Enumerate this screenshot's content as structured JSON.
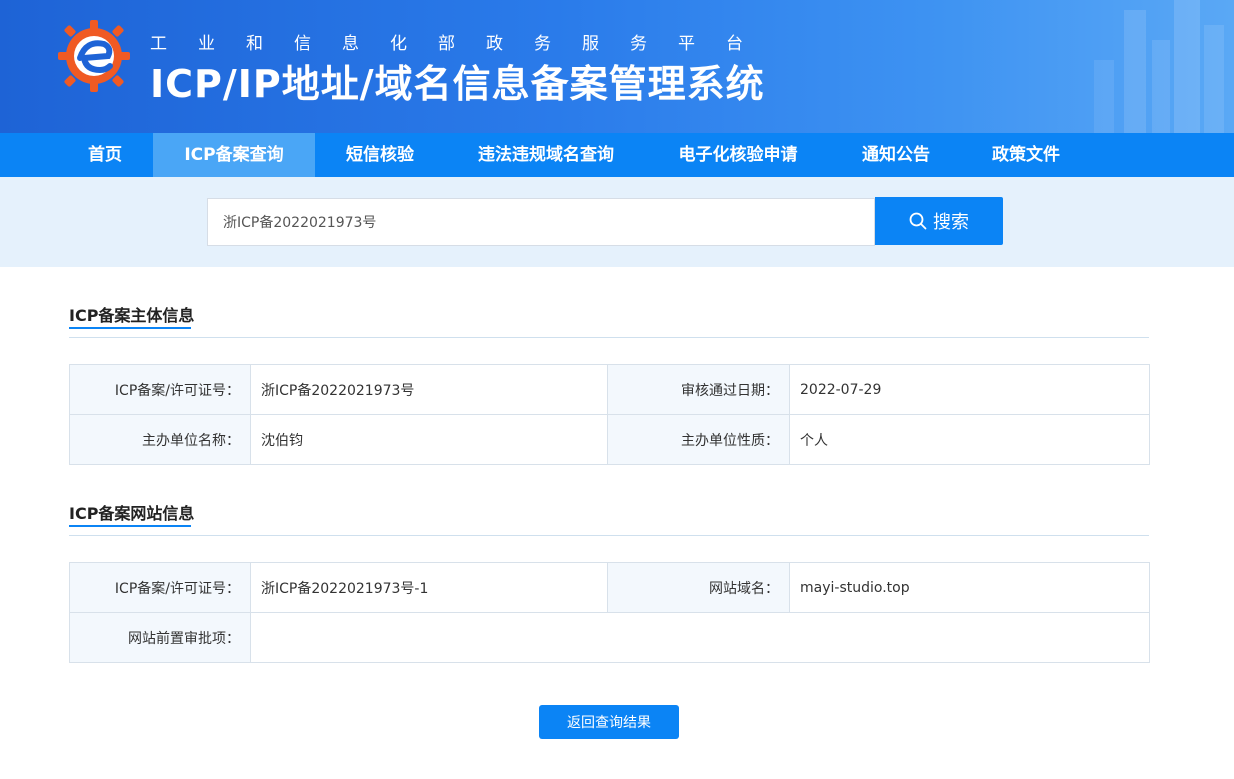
{
  "header": {
    "subtitle": "工业和信息化部政务服务平台",
    "title": "ICP/IP地址/域名信息备案管理系统"
  },
  "nav": {
    "items": [
      {
        "label": "首页"
      },
      {
        "label": "ICP备案查询"
      },
      {
        "label": "短信核验"
      },
      {
        "label": "违法违规域名查询"
      },
      {
        "label": "电子化核验申请"
      },
      {
        "label": "通知公告"
      },
      {
        "label": "政策文件"
      }
    ],
    "active_index": 1
  },
  "search": {
    "value": "浙ICP备2022021973号",
    "button_label": "搜索",
    "button_icon": "search-icon"
  },
  "entity_section": {
    "title": "ICP备案主体信息",
    "rows": [
      {
        "label1": "ICP备案/许可证号：",
        "value1": "浙ICP备2022021973号",
        "label2": "审核通过日期：",
        "value2": "2022-07-29"
      },
      {
        "label1": "主办单位名称：",
        "value1": "沈伯钧",
        "label2": "主办单位性质：",
        "value2": "个人"
      }
    ]
  },
  "website_section": {
    "title": "ICP备案网站信息",
    "rows": [
      {
        "label1": "ICP备案/许可证号：",
        "value1": "浙ICP备2022021973号-1",
        "label2": "网站域名：",
        "value2": "mayi-studio.top"
      },
      {
        "label1": "网站前置审批项：",
        "value1": ""
      }
    ]
  },
  "actions": {
    "return_label": "返回查询结果"
  },
  "colors": {
    "primary": "#0b84f5",
    "nav_active": "#4aa6f6",
    "search_zone_bg": "#e5f1fc",
    "label_cell_bg": "#f3f8fd",
    "logo_orange": "#f05a23"
  }
}
